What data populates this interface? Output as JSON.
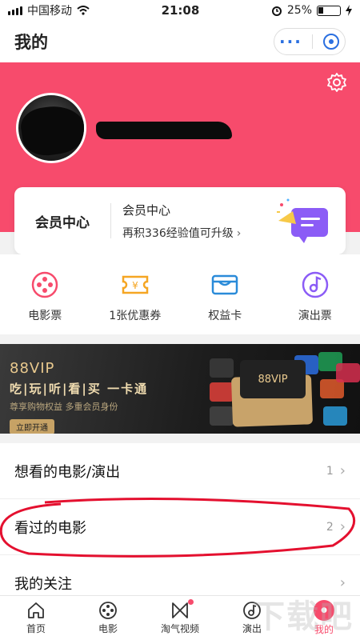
{
  "status_bar": {
    "carrier": "中国移动",
    "time": "21:08",
    "battery": "25%"
  },
  "header": {
    "title": "我的",
    "more_icon": "more-dots-icon",
    "close_icon": "target-close-icon"
  },
  "hero": {
    "bg_color": "#f74b6c"
  },
  "member_card": {
    "title": "会员中心",
    "name": "会员中心",
    "exp_text": "再积336经验值可升级"
  },
  "quick_actions": [
    {
      "label": "电影票",
      "icon": "film-reel-icon"
    },
    {
      "label": "1张优惠券",
      "icon": "coupon-icon"
    },
    {
      "label": "权益卡",
      "icon": "card-icon"
    },
    {
      "label": "演出票",
      "icon": "music-note-icon"
    }
  ],
  "banner": {
    "vip": "88VIP",
    "line": "吃|玩|听|看|买  一卡通",
    "sub": "尊享购物权益 多重会员身份",
    "cta": "立即开通",
    "card_label": "88VIP"
  },
  "list": [
    {
      "label": "想看的电影/演出",
      "count": "1"
    },
    {
      "label": "看过的电影",
      "count": "2"
    },
    {
      "label": "我的关注",
      "count": ""
    }
  ],
  "tabs": [
    {
      "label": "首页",
      "icon": "home-icon"
    },
    {
      "label": "电影",
      "icon": "film-reel-icon"
    },
    {
      "label": "淘气视频",
      "icon": "video-icon"
    },
    {
      "label": "演出",
      "icon": "music-note-icon"
    },
    {
      "label": "我的",
      "icon": "mine-icon"
    }
  ],
  "watermark": "下载吧",
  "colors": {
    "accent": "#f74b6c",
    "blue": "#2a6fe0"
  }
}
